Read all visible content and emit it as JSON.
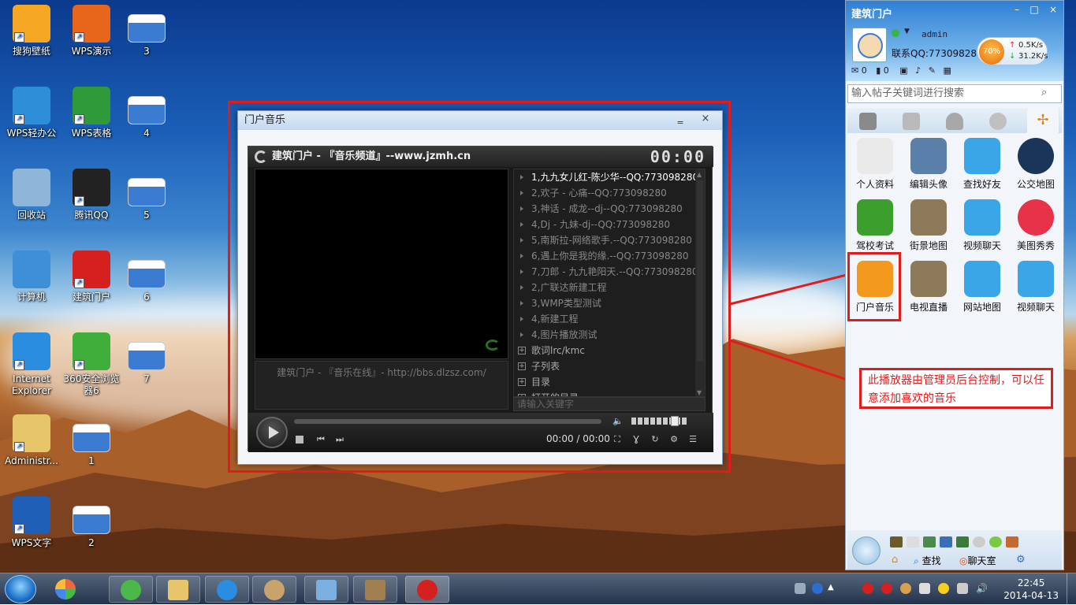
{
  "desktop": {
    "icons": [
      {
        "label": "搜狗壁纸",
        "icon": "sogou-wallpaper-icon",
        "color": "#f5a623"
      },
      {
        "label": "WPS演示",
        "icon": "wps-presentation-icon",
        "color": "#e8661c"
      },
      {
        "label": "3",
        "icon": "screenshot-thumbnail-icon",
        "color": "#3b7bd1"
      },
      {
        "label": "WPS轻办公",
        "icon": "wps-light-office-icon",
        "color": "#2e8ed8"
      },
      {
        "label": "WPS表格",
        "icon": "wps-spreadsheet-icon",
        "color": "#2f9a3a"
      },
      {
        "label": "4",
        "icon": "screenshot-thumbnail-icon",
        "color": "#3b7bd1"
      },
      {
        "label": "回收站",
        "icon": "recycle-bin-icon",
        "color": "#8fb6d9"
      },
      {
        "label": "腾讯QQ",
        "icon": "qq-penguin-icon",
        "color": "#222222"
      },
      {
        "label": "5",
        "icon": "screenshot-thumbnail-icon",
        "color": "#3b7bd1"
      },
      {
        "label": "计算机",
        "icon": "computer-icon",
        "color": "#3f8fd8"
      },
      {
        "label": "建筑门户",
        "icon": "mushroom-app-icon",
        "color": "#d62020"
      },
      {
        "label": "6",
        "icon": "screenshot-thumbnail-icon",
        "color": "#3b7bd1"
      },
      {
        "label": "Internet Explorer",
        "icon": "internet-explorer-icon",
        "color": "#2a8de0"
      },
      {
        "label": "360安全浏览器6",
        "icon": "360-browser-icon",
        "color": "#3fae3a"
      },
      {
        "label": "7",
        "icon": "screenshot-thumbnail-icon",
        "color": "#3b7bd1"
      },
      {
        "label": "Administr...",
        "icon": "user-folder-icon",
        "color": "#e7c56b"
      },
      {
        "label": "1",
        "icon": "screenshot-thumbnail-icon",
        "color": "#3b7bd1"
      },
      {
        "label": "WPS文字",
        "icon": "wps-writer-icon",
        "color": "#1f5fb8"
      },
      {
        "label": "2",
        "icon": "screenshot-thumbnail-icon",
        "color": "#3b7bd1"
      }
    ]
  },
  "player_window": {
    "title": "门户音乐",
    "minimize": "‗",
    "close": "×",
    "header": "建筑门户 - 『音乐频道』--www.jzmh.cn",
    "time_display": "00:00",
    "video_caption": "建筑门户 - 『音乐在线』- http://bbs.dlzsz.com/",
    "playlist": [
      {
        "text": "1,九九女儿红-陈少华--QQ:773098280",
        "selected": true
      },
      {
        "text": "2,欢子 - 心痛--QQ:773098280"
      },
      {
        "text": "3,神话 - 成龙--dj--QQ:773098280"
      },
      {
        "text": "4,Dj - 九妹-dj--QQ:773098280"
      },
      {
        "text": "5,南斯拉-网络歌手.--QQ:773098280"
      },
      {
        "text": "6,遇上你是我的缘.--QQ:773098280"
      },
      {
        "text": "7,刀郎 - 九九艳阳天.--QQ:773098280"
      },
      {
        "text": "2,广联达新建工程"
      },
      {
        "text": "3,WMP类型测试"
      },
      {
        "text": "4,新建工程"
      },
      {
        "text": "4,图片播放测试"
      }
    ],
    "groups": [
      "歌词lrc/kmc",
      "子列表",
      "目录",
      "打开的目录"
    ],
    "search_placeholder": "请输入关键字",
    "elapsed": "00:00 / 00:00",
    "volume_level": 0.85
  },
  "panel": {
    "title": "建筑门户",
    "username": "admin",
    "contact": "联系QQ:773098280",
    "cpu": "70%",
    "upload": "0.5K/s",
    "download": "31.2K/s",
    "mail_count": "0",
    "msg_count": "0",
    "search_placeholder": "输入帖子关键词进行搜索",
    "apps": [
      {
        "label": "个人资料",
        "icon": "profile-doc-icon",
        "color": "#eaeaea"
      },
      {
        "label": "编辑头像",
        "icon": "edit-avatar-icon",
        "color": "#5a7fa8"
      },
      {
        "label": "查找好友",
        "icon": "key-icon",
        "color": "#3aa6e8"
      },
      {
        "label": "公交地图",
        "icon": "globe-icon",
        "color": "#1b3558"
      },
      {
        "label": "驾校考试",
        "icon": "driving-school-icon",
        "color": "#3c9e2c"
      },
      {
        "label": "街景地图",
        "icon": "tv-icon",
        "color": "#8c7a5a"
      },
      {
        "label": "视频聊天",
        "icon": "key-icon",
        "color": "#3aa6e8"
      },
      {
        "label": "美图秀秀",
        "icon": "meitu-icon",
        "color": "#e8324a"
      },
      {
        "label": "门户音乐",
        "icon": "music-note-icon",
        "color": "#f39a1e"
      },
      {
        "label": "电视直播",
        "icon": "tv-icon",
        "color": "#8c7a5a"
      },
      {
        "label": "网站地图",
        "icon": "key-icon",
        "color": "#3aa6e8"
      },
      {
        "label": "视频聊天",
        "icon": "key-icon",
        "color": "#3aa6e8"
      }
    ],
    "footer": {
      "search": "查找",
      "chat": "聊天室"
    }
  },
  "annotation": "此播放器由管理员后台控制，可以任意添加喜欢的音乐",
  "taskbar": {
    "time": "22:45",
    "date": "2014-04-13"
  }
}
